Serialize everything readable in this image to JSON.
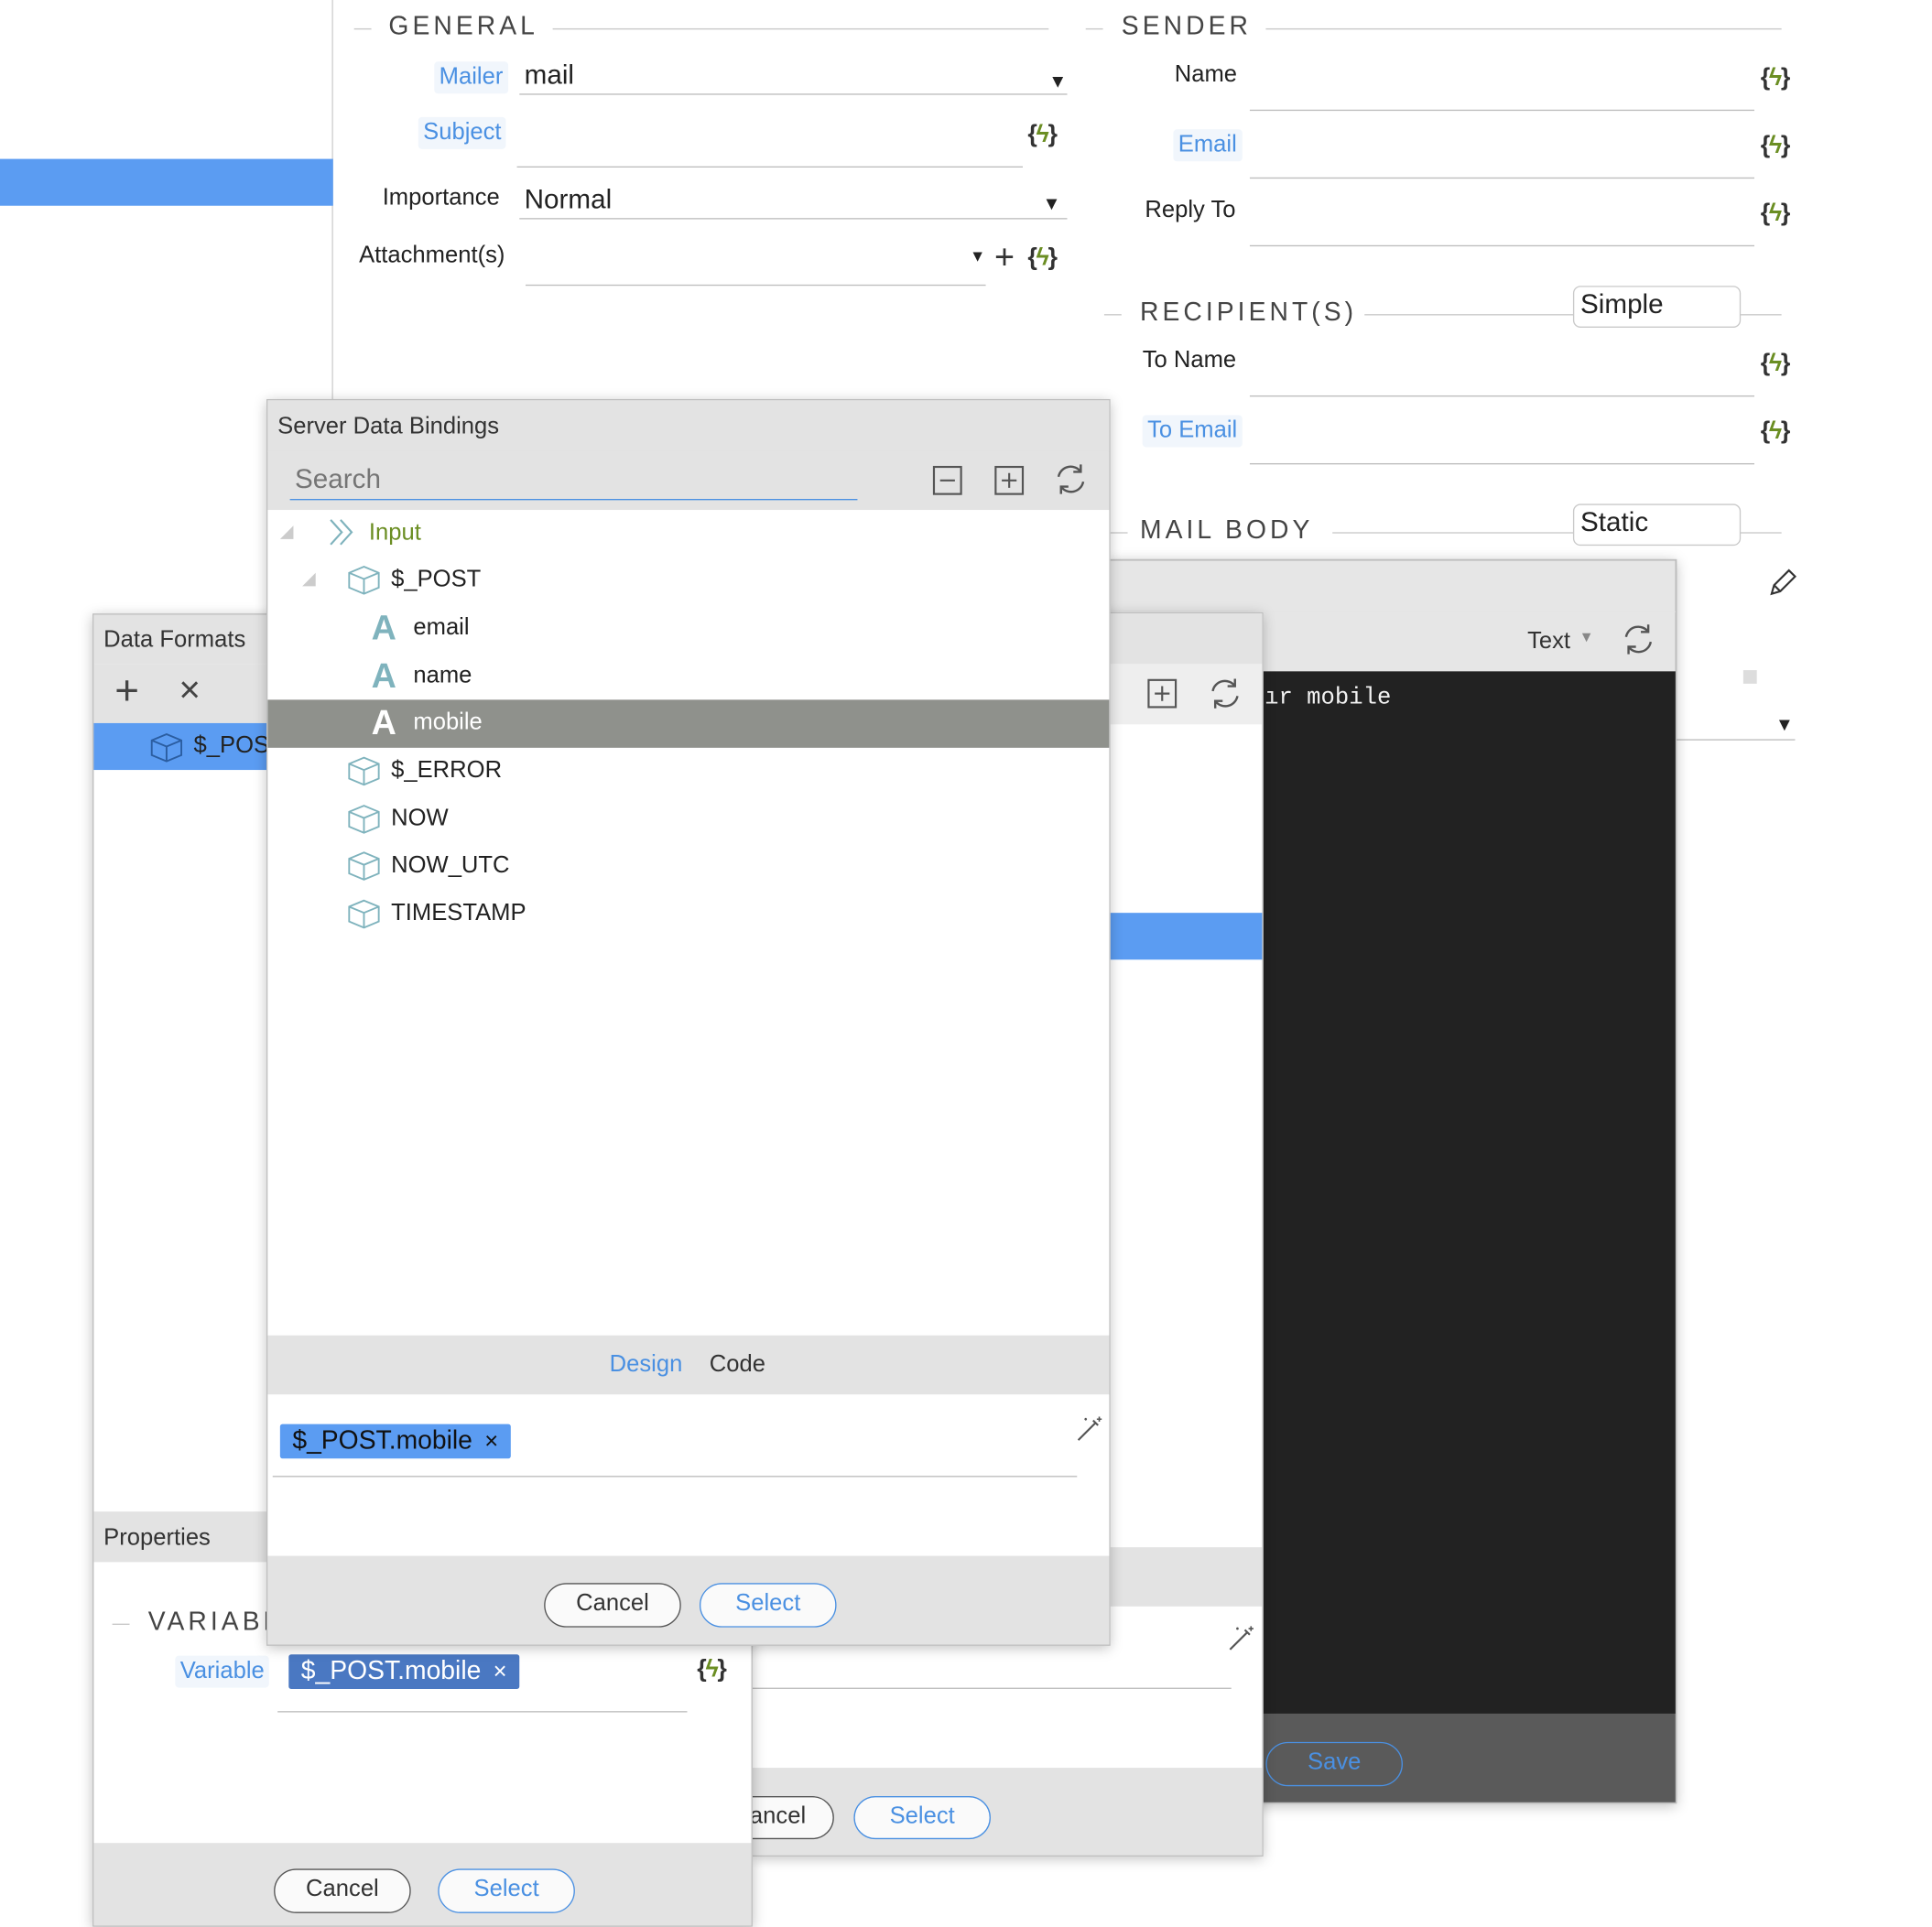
{
  "general": {
    "title": "GENERAL",
    "mailer_label": "Mailer",
    "mailer_value": "mail",
    "subject_label": "Subject",
    "importance_label": "Importance",
    "importance_value": "Normal",
    "attachments_label": "Attachment(s)"
  },
  "sender": {
    "title": "SENDER",
    "name_label": "Name",
    "email_label": "Email",
    "reply_label": "Reply To"
  },
  "recipients": {
    "title": "RECIPIENT(S)",
    "mode": "Simple",
    "to_name_label": "To Name",
    "to_email_label": "To Email"
  },
  "mail_body": {
    "title": "MAIL BODY",
    "mode": "Static"
  },
  "editor_window": {
    "format": "Text",
    "code_text": "ır mobile",
    "save_label": "Save"
  },
  "middle_dialog": {
    "cancel_label": "ancel",
    "select_label": "Select"
  },
  "data_formats": {
    "title": "Data Formats",
    "item": "$_POS",
    "properties_title": "Properties",
    "variable_section": "VARIABL",
    "variable_label": "Variable",
    "variable_tag": "$_POST.mobile",
    "cancel_label": "Cancel",
    "select_label": "Select"
  },
  "bindings": {
    "title": "Server Data Bindings",
    "search_placeholder": "Search",
    "tree": {
      "root": "Input",
      "post": "$_POST",
      "email": "email",
      "name": "name",
      "mobile": "mobile",
      "error": "$_ERROR",
      "now": "NOW",
      "now_utc": "NOW_UTC",
      "timestamp": "TIMESTAMP"
    },
    "tab_design": "Design",
    "tab_code": "Code",
    "selected_tag": "$_POST.mobile",
    "cancel_label": "Cancel",
    "select_label": "Select"
  },
  "colors": {
    "accent": "#5b9cf2",
    "selected_row": "#8f918c",
    "dynamic_green": "#6b8e23"
  }
}
